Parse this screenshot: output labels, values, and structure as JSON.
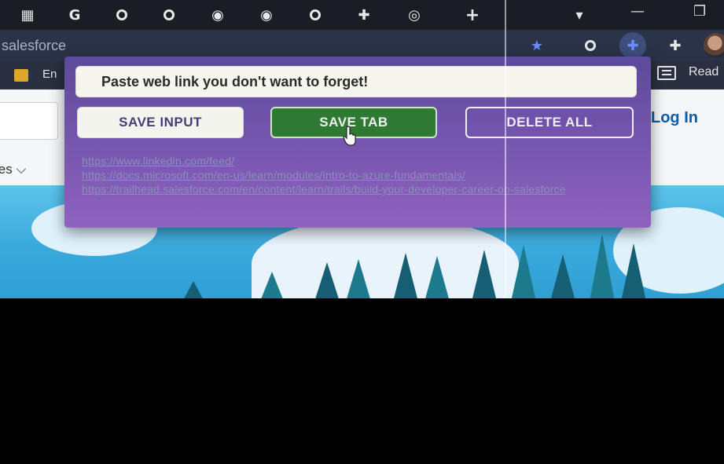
{
  "browser": {
    "tab_strip_icons": [
      {
        "name": "calendar-icon",
        "glyph": "▦"
      },
      {
        "name": "google-icon",
        "glyph": "G"
      },
      {
        "name": "tab-icon-1",
        "glyph": "ring"
      },
      {
        "name": "tab-icon-2",
        "glyph": "ring"
      },
      {
        "name": "globe-icon-1",
        "glyph": "◉"
      },
      {
        "name": "globe-icon-2",
        "glyph": "◉"
      },
      {
        "name": "tab-icon-3",
        "glyph": "ring"
      },
      {
        "name": "puzzle-icon",
        "glyph": "✚"
      },
      {
        "name": "chrome-icon",
        "glyph": "◎"
      }
    ],
    "new_tab_glyph": "+",
    "tab_search_glyph": "▾",
    "minimize_glyph": "—",
    "restore_glyph": "❐",
    "address_text": "salesforce",
    "bookmark_label": "En",
    "reading_list_label": "Read"
  },
  "page": {
    "nav_fragment": "ies ⌵",
    "login_label": "Log In"
  },
  "popup": {
    "input_placeholder": "Paste web link you don't want to forget!",
    "save_input_label": "SAVE INPUT",
    "save_tab_label": "SAVE TAB",
    "delete_all_label": "DELETE ALL",
    "saved_links": [
      "https://www.linkedin.com/feed/",
      "https://docs.microsoft.com/en-us/learn/modules/intro-to-azure-fundamentals/",
      "https://trailhead.salesforce.com/en/content/learn/trails/build-your-developer-career-on-salesforce"
    ]
  },
  "colors": {
    "popup_purple": "#7a58b2",
    "save_tab_green": "#2f7a32",
    "salesforce_blue": "#0b5cab"
  }
}
